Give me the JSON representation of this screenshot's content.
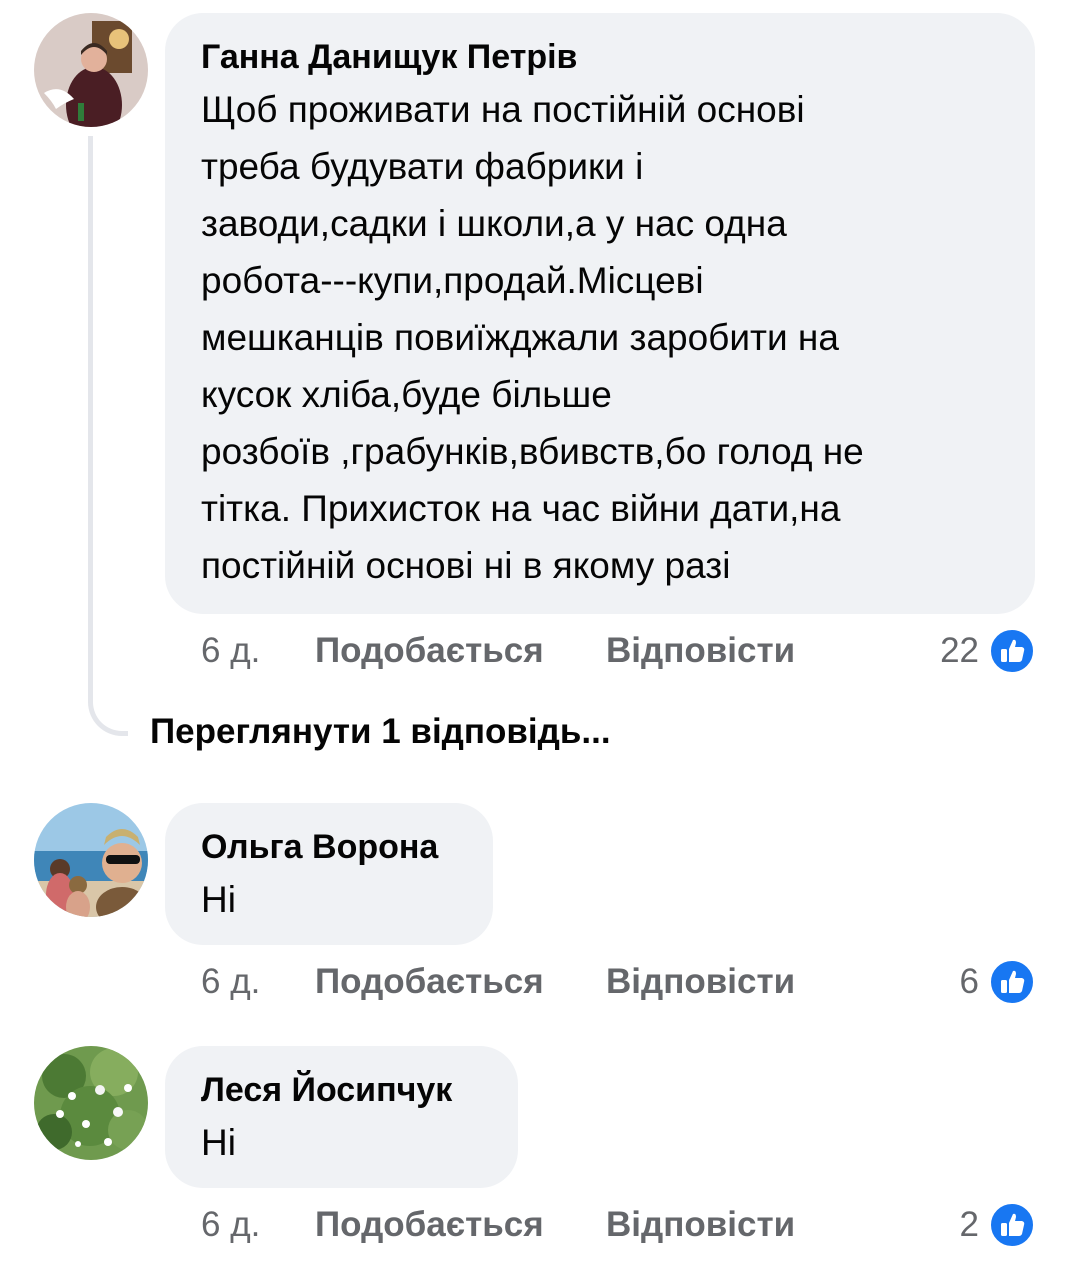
{
  "comments": [
    {
      "author": "Ганна Данищук Петрів",
      "text": "Щоб проживати на постійній основі\nтреба будувати фабрики і\nзаводи,садки і школи,а у нас одна\nробота---купи,продай.Місцеві\nмешканців  повиїжджали заробити на\nкусок хліба,буде більше\nрозбоїв ,грабунків,вбивств,бо голод не\nтітка. Прихисток на час війни дати,на\nпостійній основі ні в якому разі",
      "time": "6 д.",
      "like_label": "Подобається",
      "reply_label": "Відповісти",
      "reaction_count": "22"
    },
    {
      "author": "Ольга Ворона",
      "text": "Ні",
      "time": "6 д.",
      "like_label": "Подобається",
      "reply_label": "Відповісти",
      "reaction_count": "6"
    },
    {
      "author": "Леся Йосипчук",
      "text": "Ні",
      "time": "6 д.",
      "like_label": "Подобається",
      "reply_label": "Відповісти",
      "reaction_count": "2"
    }
  ],
  "view_replies_label": "Переглянути 1 відповідь...",
  "colors": {
    "bubble": "#f0f2f5",
    "like_blue": "#1877f2",
    "muted_text": "#65676b",
    "thread_line": "#e4e6eb"
  },
  "icons": {
    "reaction": "like-thumbs-up-icon"
  }
}
